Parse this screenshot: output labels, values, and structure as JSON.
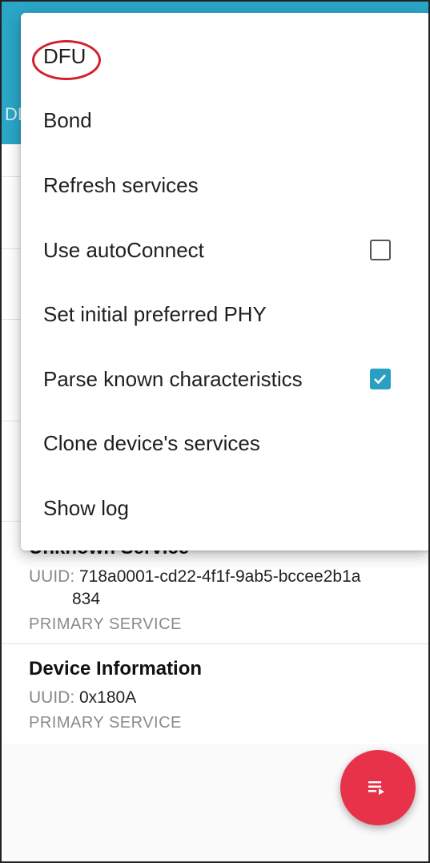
{
  "appbar": {
    "edge_text": "DE"
  },
  "services": [
    {
      "name": "Unknown Service",
      "uuid_label": "UUID: ",
      "uuid_line1": "718a0001-cd22-4f1f-9ab5-bccee2b1a",
      "uuid_line2": "834",
      "type": "PRIMARY SERVICE"
    },
    {
      "name": "Device Information",
      "uuid_label": "UUID: ",
      "uuid_line1": "0x180A",
      "type": "PRIMARY SERVICE"
    }
  ],
  "menu": {
    "items": [
      {
        "label": "DFU"
      },
      {
        "label": "Bond"
      },
      {
        "label": "Refresh services"
      },
      {
        "label": "Use autoConnect",
        "checked": false
      },
      {
        "label": "Set initial preferred PHY"
      },
      {
        "label": "Parse known characteristics",
        "checked": true
      },
      {
        "label": "Clone device's services"
      },
      {
        "label": "Show log"
      }
    ]
  },
  "fab": {
    "icon": "list-play-icon"
  },
  "colors": {
    "appbar": "#2ba6c7",
    "accent_checkbox": "#2a9fc4",
    "fab": "#e8324a",
    "highlight": "#d3202e"
  }
}
